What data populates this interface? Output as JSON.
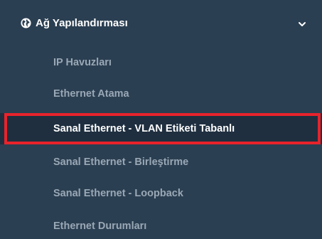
{
  "menu": {
    "header": {
      "icon": "globe-icon",
      "label": "Ağ Yapılandırması",
      "chevron": "chevron-down-icon"
    },
    "items": [
      {
        "label": "IP Havuzları",
        "active": false
      },
      {
        "label": "Ethernet Atama",
        "active": false
      },
      {
        "label": "Sanal Ethernet - VLAN Etiketi Tabanlı",
        "active": true
      },
      {
        "label": "Sanal Ethernet - Birleştirme",
        "active": false
      },
      {
        "label": "Sanal Ethernet - Loopback",
        "active": false
      },
      {
        "label": "Ethernet Durumları",
        "active": false
      }
    ]
  },
  "colors": {
    "background": "#2b3f52",
    "active_background": "#1f2f40",
    "item_text": "#9aa8b5",
    "active_text": "#ffffff",
    "highlight": "#e8232b"
  }
}
